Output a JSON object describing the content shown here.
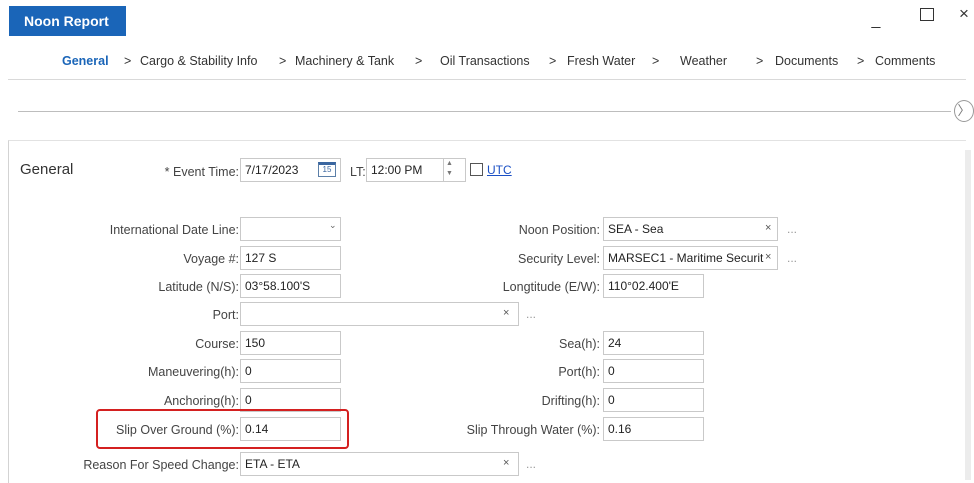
{
  "window": {
    "title": "Noon Report",
    "minimize_icon": "minimize-icon",
    "maximize_icon": "maximize-icon",
    "close_icon": "close-icon",
    "minimize_glyph": "_",
    "close_glyph": "×"
  },
  "breadcrumb": {
    "separator": ">",
    "items": [
      "General",
      "Cargo & Stability Info",
      "Machinery & Tank",
      "Oil Transactions",
      "Fresh Water",
      "Weather",
      "Documents",
      "Comments"
    ]
  },
  "nav_button_glyph": "〉",
  "section": {
    "title": "General"
  },
  "form": {
    "event_time": {
      "label": "* Event Time:",
      "date": "7/17/2023",
      "calendar_icon_text": "15",
      "lt_label": "LT:",
      "time": "12:00 PM",
      "utc_label": "UTC",
      "utc_checked": false
    },
    "international_date_line": {
      "label": "International Date Line:",
      "value": ""
    },
    "noon_position": {
      "label": "Noon Position:",
      "value": "SEA - Sea"
    },
    "voyage": {
      "label": "Voyage #:",
      "value": "127 S"
    },
    "security_level": {
      "label": "Security Level:",
      "value": "MARSEC1 - Maritime Securit"
    },
    "latitude": {
      "label": "Latitude (N/S):",
      "value": "03°58.100'S"
    },
    "longitude": {
      "label": "Longtitude (E/W):",
      "value": "110°02.400'E"
    },
    "port": {
      "label": "Port:",
      "value": ""
    },
    "course": {
      "label": "Course:",
      "value": "150"
    },
    "sea_h": {
      "label": "Sea(h):",
      "value": "24"
    },
    "maneuvering_h": {
      "label": "Maneuvering(h):",
      "value": "0"
    },
    "port_h": {
      "label": "Port(h):",
      "value": "0"
    },
    "anchoring_h": {
      "label": "Anchoring(h):",
      "value": "0"
    },
    "drifting_h": {
      "label": "Drifting(h):",
      "value": "0"
    },
    "slip_over_ground": {
      "label": "Slip Over Ground (%):",
      "value": "0.14"
    },
    "slip_through_water": {
      "label": "Slip Through Water (%):",
      "value": "0.16"
    },
    "reason_speed_change": {
      "label": "Reason For Speed Change:",
      "value": "ETA - ETA"
    }
  },
  "glyphs": {
    "clear": "×",
    "more": "...",
    "dropdown": "⌄"
  },
  "colors": {
    "accent": "#1a65b8",
    "highlight": "#d42020"
  }
}
